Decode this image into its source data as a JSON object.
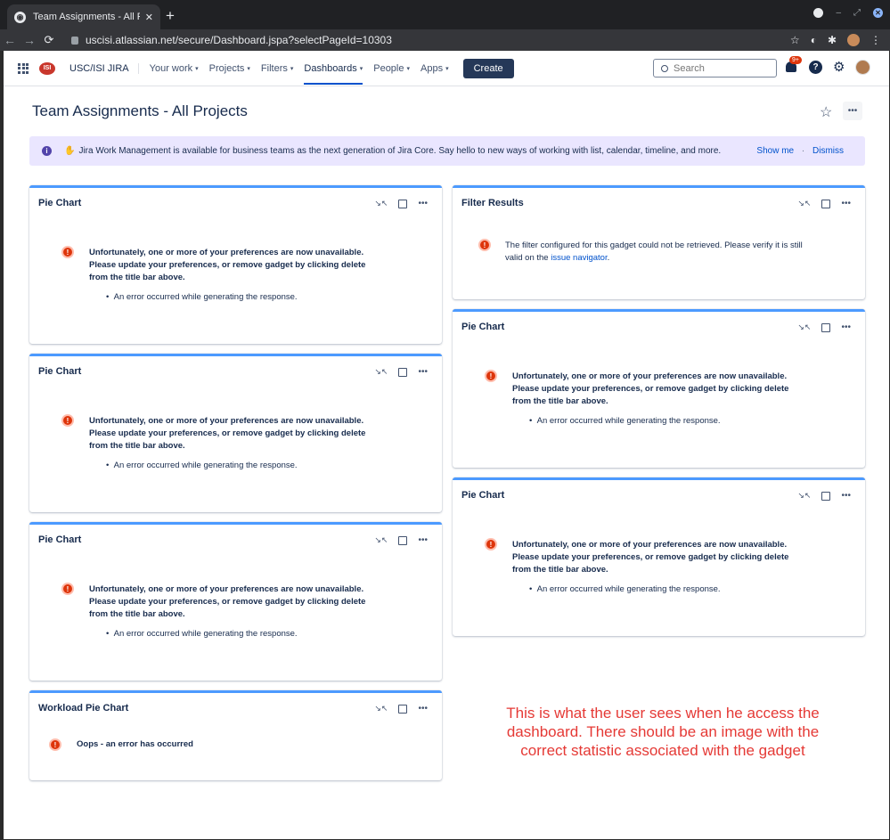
{
  "browser": {
    "tab_title": "Team Assignments - All Projects",
    "url": "uscisi.atlassian.net/secure/Dashboard.jspa?selectPageId=10303"
  },
  "nav": {
    "site_name": "USC/ISI JIRA",
    "logo_text": "ISI",
    "menu": {
      "your_work": "Your work",
      "projects": "Projects",
      "filters": "Filters",
      "dashboards": "Dashboards",
      "people": "People",
      "apps": "Apps"
    },
    "create_label": "Create",
    "search_placeholder": "Search",
    "notif_badge": "9+"
  },
  "page": {
    "title": "Team Assignments - All Projects"
  },
  "banner": {
    "text": "Jira Work Management is available for business teams as the next generation of Jira Core. Say hello to new ways of working with list, calendar, timeline, and more.",
    "show_me": "Show me",
    "separator": "·",
    "dismiss": "Dismiss"
  },
  "gadgets": {
    "pie_title": "Pie Chart",
    "filter_title": "Filter Results",
    "workload_title": "Workload Pie Chart",
    "err_line1": "Unfortunately, one or more of your preferences are now unavailable.",
    "err_line2": "Please update your preferences, or remove gadget by clicking delete",
    "err_line3": "from the title bar above.",
    "bullet": "An error occurred while generating the response.",
    "filter_msg_1": "The filter configured for this gadget could not be retrieved. Please verify it is still",
    "filter_msg_2": "valid on the",
    "filter_link": "issue navigator",
    "filter_end": ".",
    "oops": "Oops - an error has occurred"
  },
  "annotation": {
    "line1": "This is what the user sees when he access the",
    "line2": "dashboard.  There should be an image with the",
    "line3": "correct statistic associated with the gadget"
  },
  "colors": {
    "gadget_top_border": "#4c9aff",
    "error_red": "#de350b",
    "annotation_red": "#e53935",
    "banner_bg": "#eae6ff"
  }
}
